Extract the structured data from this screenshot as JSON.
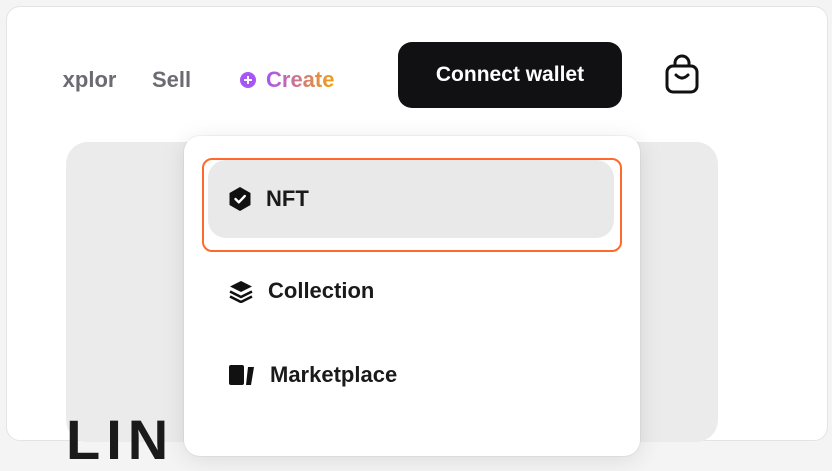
{
  "nav": {
    "explore_label": "Explore",
    "sell_label": "Sell",
    "create_label": "Create",
    "connect_wallet_label": "Connect wallet",
    "cart_icon": "shopping-bag-icon"
  },
  "create_menu": {
    "items": [
      {
        "label": "NFT",
        "icon": "nft-hexagon-icon",
        "state": "highlighted"
      },
      {
        "label": "Collection",
        "icon": "layers-icon"
      },
      {
        "label": "Marketplace",
        "icon": "storefront-icon"
      }
    ]
  },
  "hero": {
    "partial_text": "LIN"
  },
  "colors": {
    "accent_purple": "#a855f7",
    "accent_orange": "#f59e0b",
    "button_dark": "#111114",
    "highlight_outline": "#ff6a2b"
  }
}
